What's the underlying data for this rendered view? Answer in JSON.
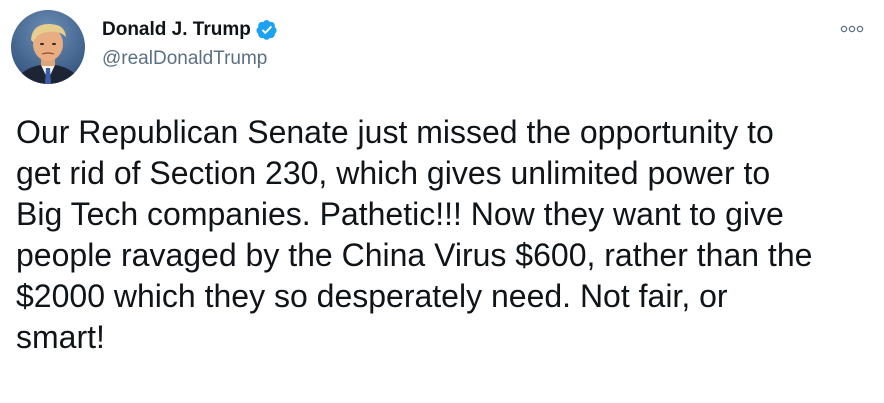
{
  "author": {
    "display_name": "Donald J. Trump",
    "handle": "@realDonaldTrump",
    "verified": true
  },
  "icons": {
    "avatar": "profile-photo",
    "verified": "verified-badge-icon",
    "more": "more-options-icon"
  },
  "colors": {
    "verified": "#1da1f2",
    "handle": "#5b7083",
    "text": "#0f1419"
  },
  "tweet": {
    "text": "Our Republican Senate just missed the opportunity to\nget rid of Section 230, which gives unlimited power to\nBig Tech companies. Pathetic!!! Now they want to give\npeople ravaged by the China Virus $600, rather than the\n$2000 which they so desperately need. Not fair, or\nsmart!"
  }
}
